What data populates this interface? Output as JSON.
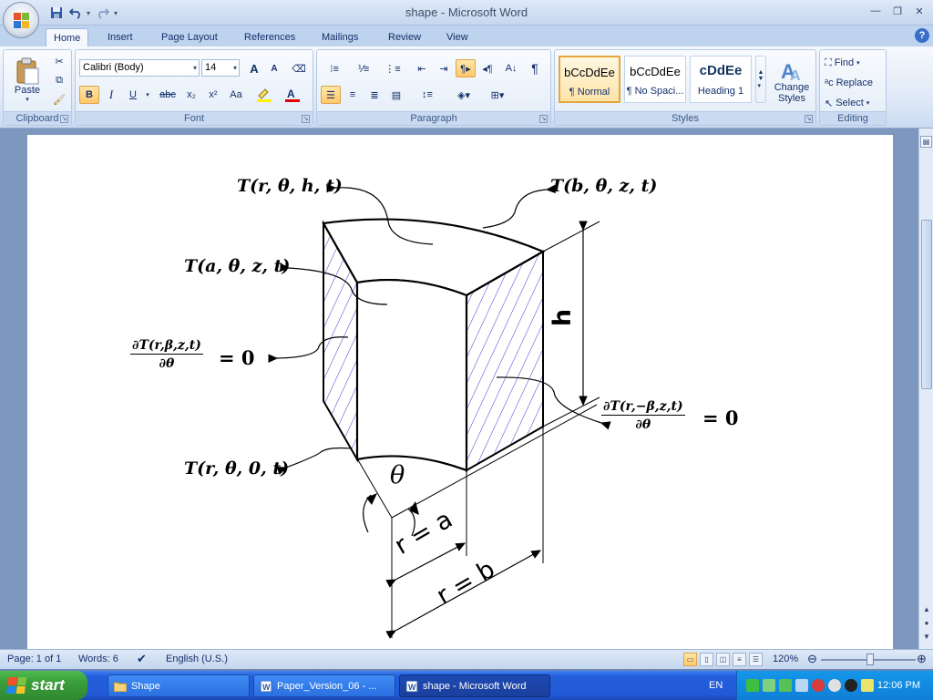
{
  "window": {
    "title": "shape - Microsoft Word",
    "controls": [
      "minimize",
      "restore",
      "close"
    ]
  },
  "qat": {
    "items": [
      "save-icon",
      "undo-icon",
      "redo-icon",
      "customize-icon"
    ]
  },
  "tabs": [
    "Home",
    "Insert",
    "Page Layout",
    "References",
    "Mailings",
    "Review",
    "View"
  ],
  "active_tab": "Home",
  "ribbon": {
    "clipboard": {
      "title": "Clipboard",
      "paste": "Paste"
    },
    "font": {
      "title": "Font",
      "family": "Calibri (Body)",
      "size": "14",
      "bold": "B",
      "italic": "I",
      "underline": "U",
      "strike": "abc",
      "subscript": "x₂",
      "superscript": "x²",
      "case": "Aa",
      "grow": "A",
      "shrink": "A"
    },
    "paragraph": {
      "title": "Paragraph"
    },
    "styles": {
      "title": "Styles",
      "items": [
        {
          "preview": "bCcDdEe",
          "name": "¶ Normal"
        },
        {
          "preview": "bCcDdEe",
          "name": "¶ No Spaci..."
        },
        {
          "preview": "cDdEe",
          "name": "Heading 1"
        }
      ],
      "change": "Change\nStyles"
    },
    "editing": {
      "title": "Editing",
      "find": "Find",
      "replace": "Replace",
      "select": "Select"
    }
  },
  "diagram": {
    "labels": {
      "top": "T(r, θ, h, t)",
      "outer": "T(b, θ, z, t)",
      "inner": "T(a, θ, z, t)",
      "bottom": "T(r, θ, 0, t)",
      "left_num": "∂T(r,β,z,t)",
      "left_den": "∂θ",
      "right_num": "∂T(r,−β,z,t)",
      "right_den": "∂θ",
      "eq_zero": "= 0",
      "height": "h",
      "angle": "θ",
      "ra": "r = a",
      "rb": "r = b"
    }
  },
  "status": {
    "page": "Page: 1 of 1",
    "words": "Words: 6",
    "language": "English (U.S.)",
    "zoom": "120%"
  },
  "taskbar": {
    "start": "start",
    "tasks": [
      {
        "label": "Shape",
        "active": false
      },
      {
        "label": "Paper_Version_06 - ...",
        "active": false
      },
      {
        "label": "shape - Microsoft Word",
        "active": true
      }
    ],
    "lang": "EN",
    "clock": "12:06 PM"
  }
}
